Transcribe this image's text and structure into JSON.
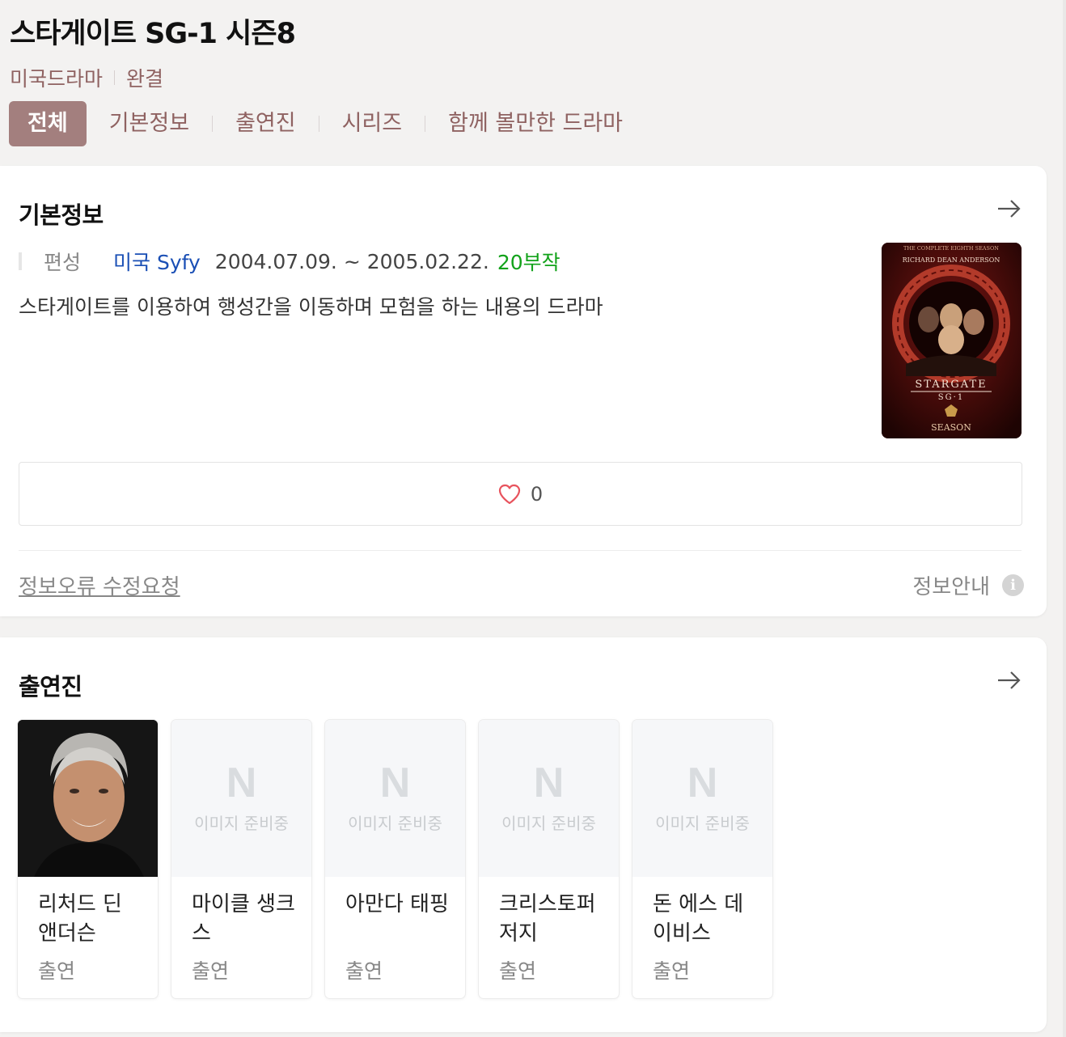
{
  "header": {
    "title": "스타게이트 SG-1 시즌8",
    "genre": "미국드라마",
    "status": "완결"
  },
  "tabs": [
    {
      "label": "전체",
      "active": true
    },
    {
      "label": "기본정보"
    },
    {
      "label": "출연진"
    },
    {
      "label": "시리즈"
    },
    {
      "label": "함께 볼만한 드라마"
    }
  ],
  "info": {
    "section_title": "기본정보",
    "label": "편성",
    "network": "미국 Syfy",
    "dates": "2004.07.09. ~ 2005.02.22.",
    "episodes": "20부작",
    "description": "스타게이트를 이용하여 행성간을 이동하며 모험을 하는 내용의 드라마",
    "like_count": "0",
    "report_link": "정보오류 수정요청",
    "guide": "정보안내",
    "poster": {
      "top_line": "THE COMPLETE EIGHTH SEASON",
      "actor": "RICHARD DEAN ANDERSON",
      "logo": "STARGATE",
      "sublogo": "SG·1",
      "bottom": "SEASON"
    }
  },
  "cast": {
    "section_title": "출연진",
    "placeholder_mark": "N",
    "placeholder_text": "이미지 준비중",
    "members": [
      {
        "name": "리처드 딘 앤더슨",
        "role": "출연"
      },
      {
        "name": "마이클 생크스",
        "role": "출연"
      },
      {
        "name": "아만다 태핑",
        "role": "출연"
      },
      {
        "name": "크리스토퍼 저지",
        "role": "출연"
      },
      {
        "name": "돈 에스 데이비스",
        "role": "출연"
      }
    ]
  },
  "colors": {
    "accent": "#a37f7e",
    "link_blue": "#1a4fb5",
    "episodes_green": "#12a21a",
    "heart": "#e8535d"
  }
}
